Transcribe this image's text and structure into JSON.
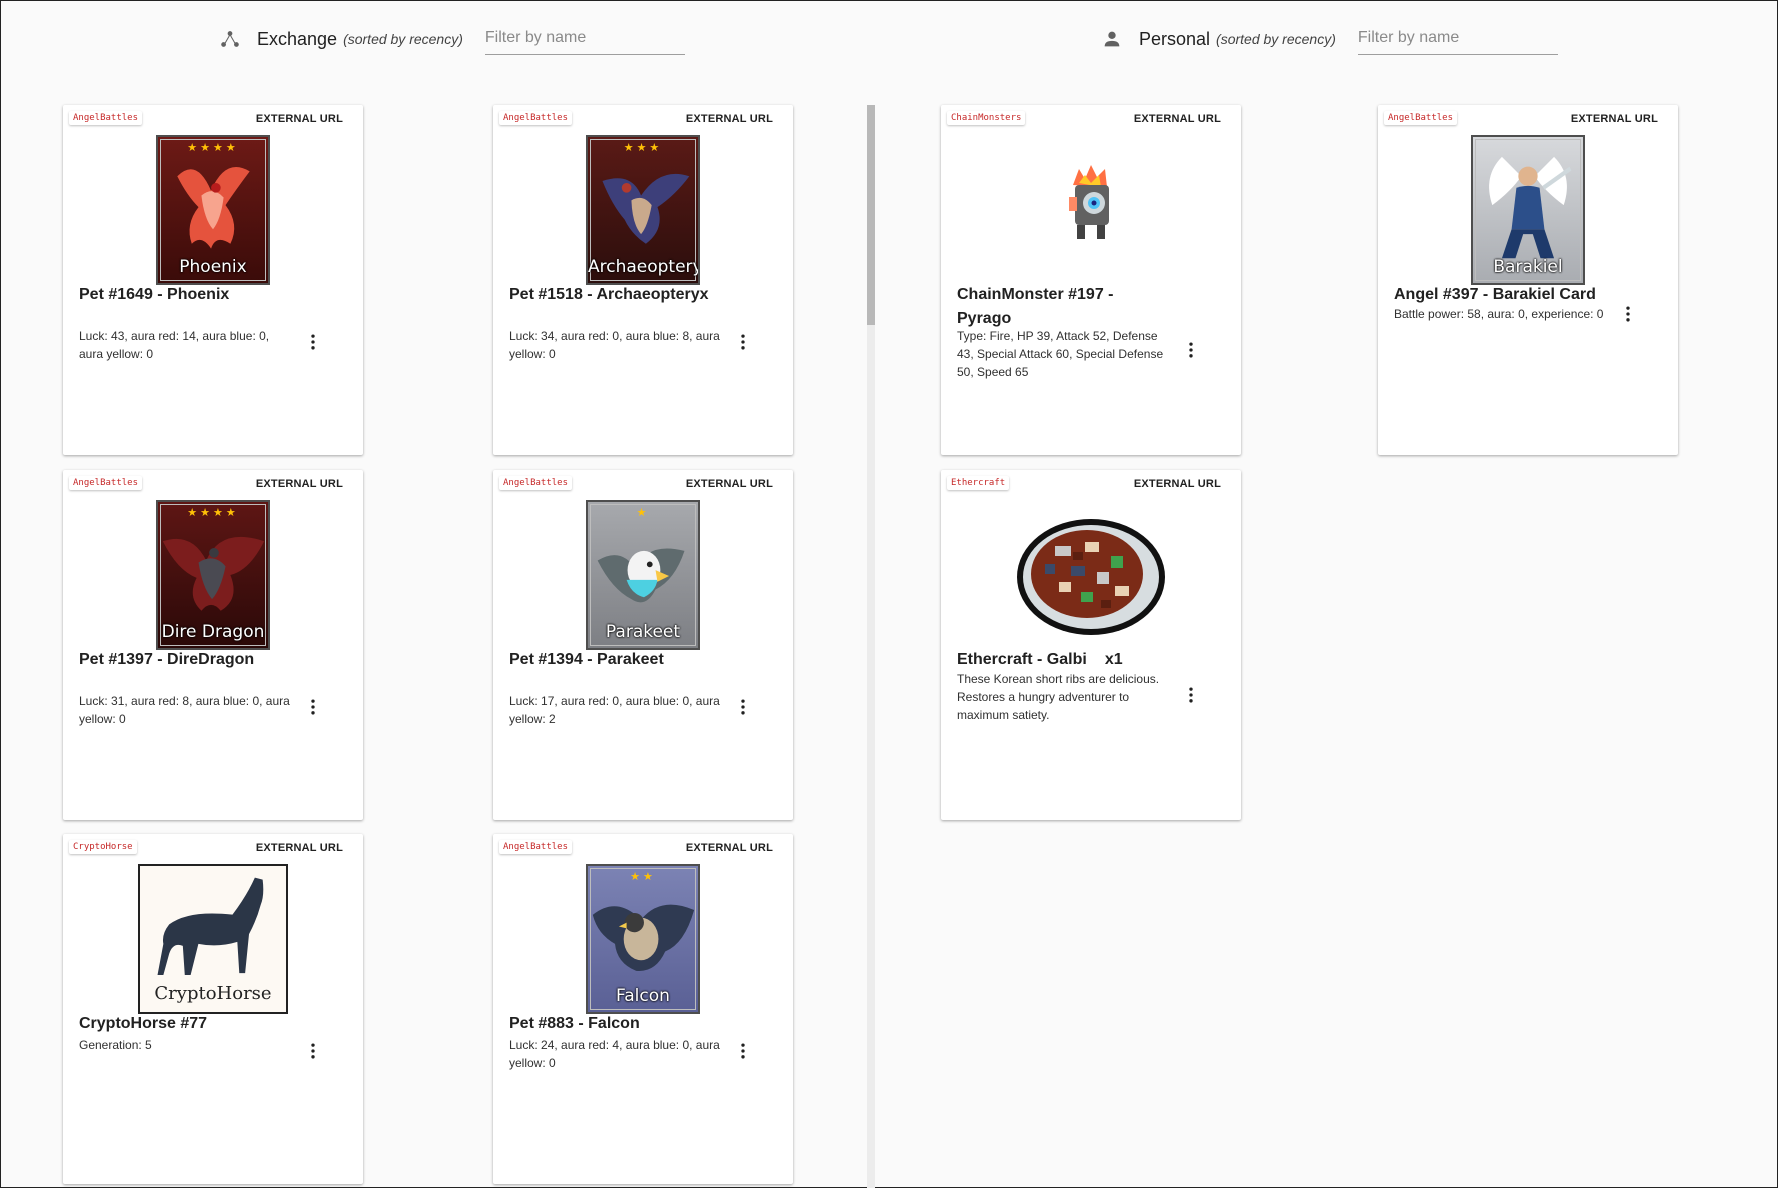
{
  "exchange": {
    "title": "Exchange",
    "subtitle": "(sorted by recency)",
    "filter_placeholder": "Filter by name",
    "icon": "share-network-icon",
    "cards": [
      {
        "tag": "AngelBattles",
        "link": "EXTERNAL URL",
        "art_label": "Phoenix",
        "stars": "★★★★",
        "title": "Pet #1649 - Phoenix",
        "desc": "Luck: 43, aura red: 14, aura blue: 0, aura yellow: 0"
      },
      {
        "tag": "AngelBattles",
        "link": "EXTERNAL URL",
        "art_label": "Archaeopteryx",
        "stars": "★★★",
        "title": "Pet #1518 - Archaeopteryx",
        "desc": "Luck: 34, aura red: 0, aura blue: 8, aura yellow: 0"
      },
      {
        "tag": "AngelBattles",
        "link": "EXTERNAL URL",
        "art_label": "Dire Dragon",
        "stars": "★★★★",
        "title": "Pet #1397 - DireDragon",
        "desc": "Luck: 31, aura red: 8, aura blue: 0, aura yellow: 0"
      },
      {
        "tag": "AngelBattles",
        "link": "EXTERNAL URL",
        "art_label": "Parakeet",
        "stars": "★",
        "title": "Pet #1394 - Parakeet",
        "desc": "Luck: 17, aura red: 0, aura blue: 0, aura yellow: 2"
      },
      {
        "tag": "CryptoHorse",
        "link": "EXTERNAL URL",
        "art_label": "CryptoHorse",
        "stars": "",
        "title": "CryptoHorse #77",
        "desc": "Generation: 5"
      },
      {
        "tag": "AngelBattles",
        "link": "EXTERNAL URL",
        "art_label": "Falcon",
        "stars": "★★",
        "title": "Pet #883 - Falcon",
        "desc": "Luck: 24, aura red: 4, aura blue: 0, aura yellow: 0"
      }
    ]
  },
  "personal": {
    "title": "Personal",
    "subtitle": "(sorted by recency)",
    "filter_placeholder": "Filter by name",
    "icon": "person-icon",
    "cards": [
      {
        "tag": "ChainMonsters",
        "link": "EXTERNAL URL",
        "title": "ChainMonster #197 - Pyrago",
        "desc": "Type: Fire, HP 39, Attack 52, Defense 43, Special Attack 60, Special Defense 50, Speed 65"
      },
      {
        "tag": "AngelBattles",
        "link": "EXTERNAL URL",
        "art_label": "Barakiel",
        "title": "Angel #397 - Barakiel Card",
        "desc": "Battle power: 58, aura: 0, experience: 0"
      },
      {
        "tag": "Ethercraft",
        "link": "EXTERNAL URL",
        "title": "Ethercraft - Galbi",
        "qty": "x1",
        "desc": "These Korean short ribs are delicious. Restores a hungry adventurer to maximum satiety."
      }
    ]
  },
  "colors": {
    "tag_text": "#c62828",
    "background": "#fafafa",
    "card": "#ffffff"
  }
}
